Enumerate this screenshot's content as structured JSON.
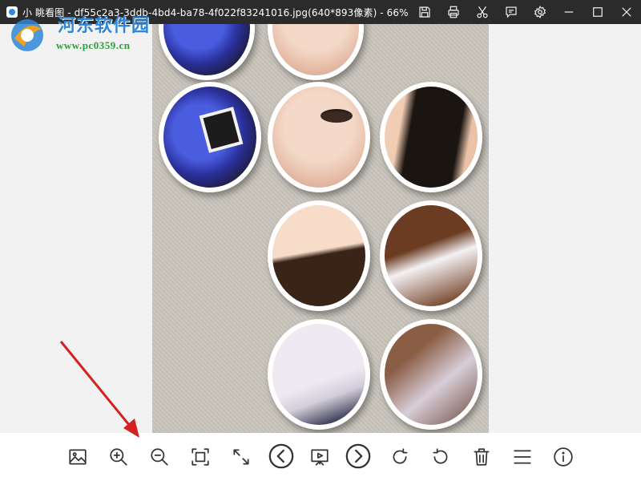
{
  "window": {
    "title": "小 眺看图 - df55c2a3-3ddb-4bd4-ba78-4f022f83241016.jpg(640*893像素) - 66%",
    "controls": [
      "save-icon",
      "print-icon",
      "scissors-icon",
      "comment-icon",
      "gear-icon",
      "minimize-icon",
      "maximize-icon",
      "close-icon"
    ]
  },
  "watermark": {
    "title": "河东软件园",
    "url": "www.pc0359.cn"
  },
  "toolbar": {
    "tools": [
      "image-icon",
      "zoom-in-icon",
      "zoom-out-icon",
      "fit-screen-icon",
      "fullscreen-icon",
      "previous-icon",
      "slideshow-icon",
      "next-icon",
      "rotate-right-icon",
      "rotate-left-icon",
      "delete-icon",
      "menu-icon",
      "info-icon"
    ]
  },
  "colors": {
    "titlebar": "#2b2b2b",
    "annotation_arrow": "#d42020",
    "watermark_blue": "#2f86d8",
    "watermark_green": "#2aa03a"
  }
}
